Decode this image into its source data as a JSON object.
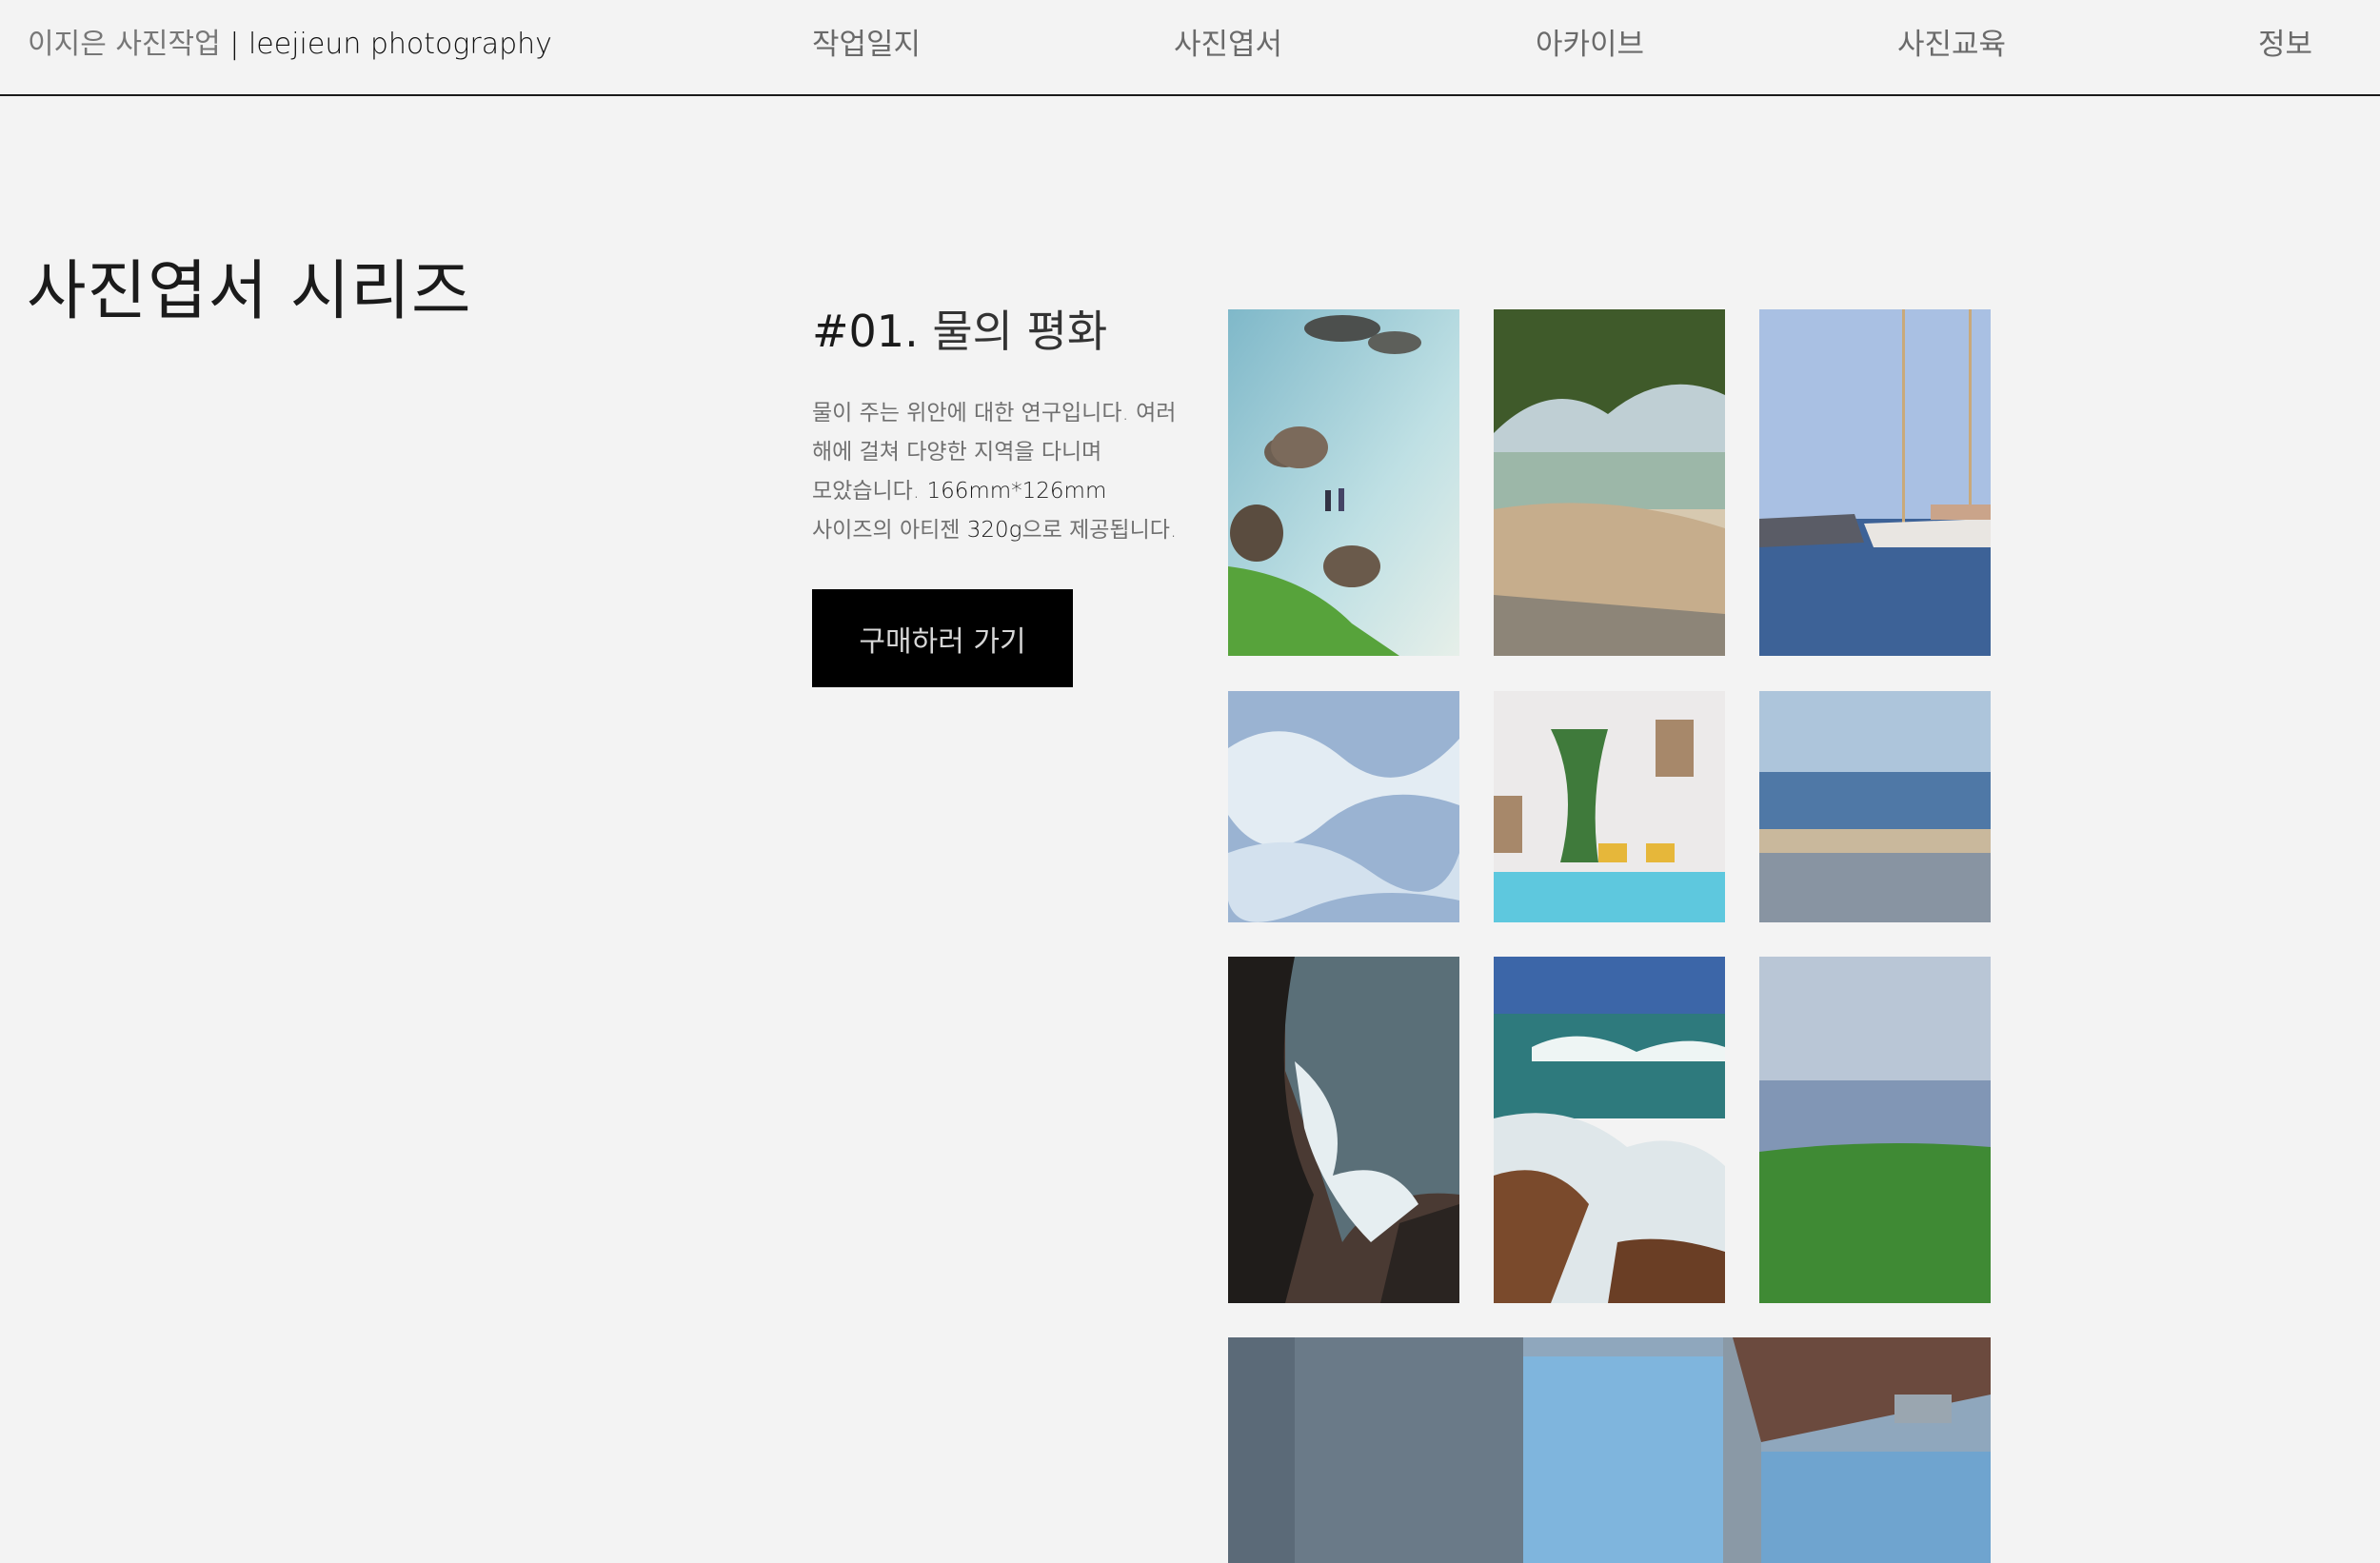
{
  "brand": {
    "ko": "이지은 사진작업",
    "separator": " | ",
    "en": "leejieun photography"
  },
  "nav": [
    {
      "label": "작업일지"
    },
    {
      "label": "사진엽서"
    },
    {
      "label": "아카이브"
    },
    {
      "label": "사진교육"
    },
    {
      "label": "정보"
    }
  ],
  "page": {
    "title": "사진엽서 시리즈"
  },
  "series": {
    "number": "#01.",
    "name": "물의 평화",
    "desc_1": "물이 주는 위안에 대한 연구입니다. 여러 해에 걸쳐 다양한 지역을 다니며 모았습니다. ",
    "size": "166mm*126mm",
    "desc_2": " 사이즈의 아티젠 ",
    "paper": "320g",
    "desc_3": "으로 제공됩니다.",
    "buy_label": "구매하러 가기"
  },
  "photos": [
    {
      "icon": "beach-rocks-photo"
    },
    {
      "icon": "tree-beach-photo"
    },
    {
      "icon": "sailboat-harbor-photo"
    },
    {
      "icon": "foam-waves-photo"
    },
    {
      "icon": "hotel-pool-photo"
    },
    {
      "icon": "sea-horizon-photo"
    },
    {
      "icon": "cliff-surf-photo"
    },
    {
      "icon": "crashing-wave-photo"
    },
    {
      "icon": "green-coast-photo"
    },
    {
      "icon": "ferry-window-photo"
    }
  ],
  "colors": {
    "background": "#f3f3f3",
    "button": "#000000",
    "button_text": "#d7d7d7"
  }
}
